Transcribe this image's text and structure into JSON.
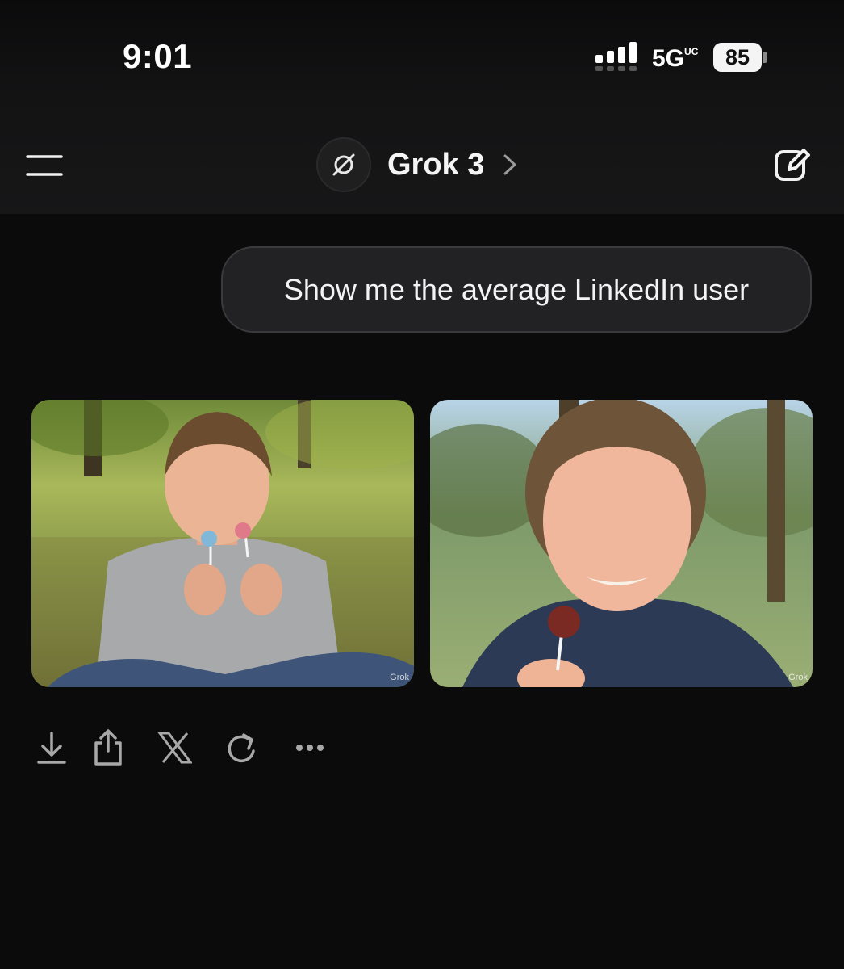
{
  "status_bar": {
    "time": "9:01",
    "network": "5G",
    "network_suffix": "UC",
    "battery": "85",
    "icons": [
      "signal-icon",
      "battery-icon"
    ]
  },
  "header": {
    "model_name": "Grok 3",
    "icons": [
      "menu-icon",
      "grok-logo-icon",
      "chevron-right-icon",
      "new-chat-icon"
    ]
  },
  "chat": {
    "user_message": "Show me the average LinkedIn user",
    "images": [
      {
        "alt": "generated image 1",
        "watermark": "Grok"
      },
      {
        "alt": "generated image 2",
        "watermark": "Grok"
      }
    ]
  },
  "actions": {
    "icons": [
      "download-icon",
      "share-icon",
      "x-logo-icon",
      "regenerate-icon",
      "more-icon"
    ]
  }
}
